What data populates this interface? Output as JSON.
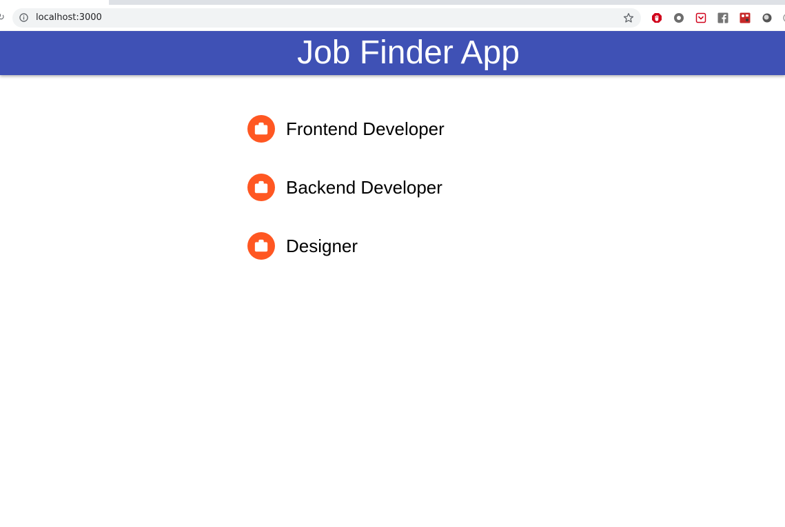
{
  "browser": {
    "url": "localhost:3000"
  },
  "header": {
    "title": "Job Finder App",
    "background": "#3f51b5"
  },
  "jobs": {
    "avatar_color": "#ff5722",
    "avatar_icon": "briefcase-icon",
    "items": [
      {
        "label": "Frontend Developer"
      },
      {
        "label": "Backend Developer"
      },
      {
        "label": "Designer"
      }
    ]
  }
}
